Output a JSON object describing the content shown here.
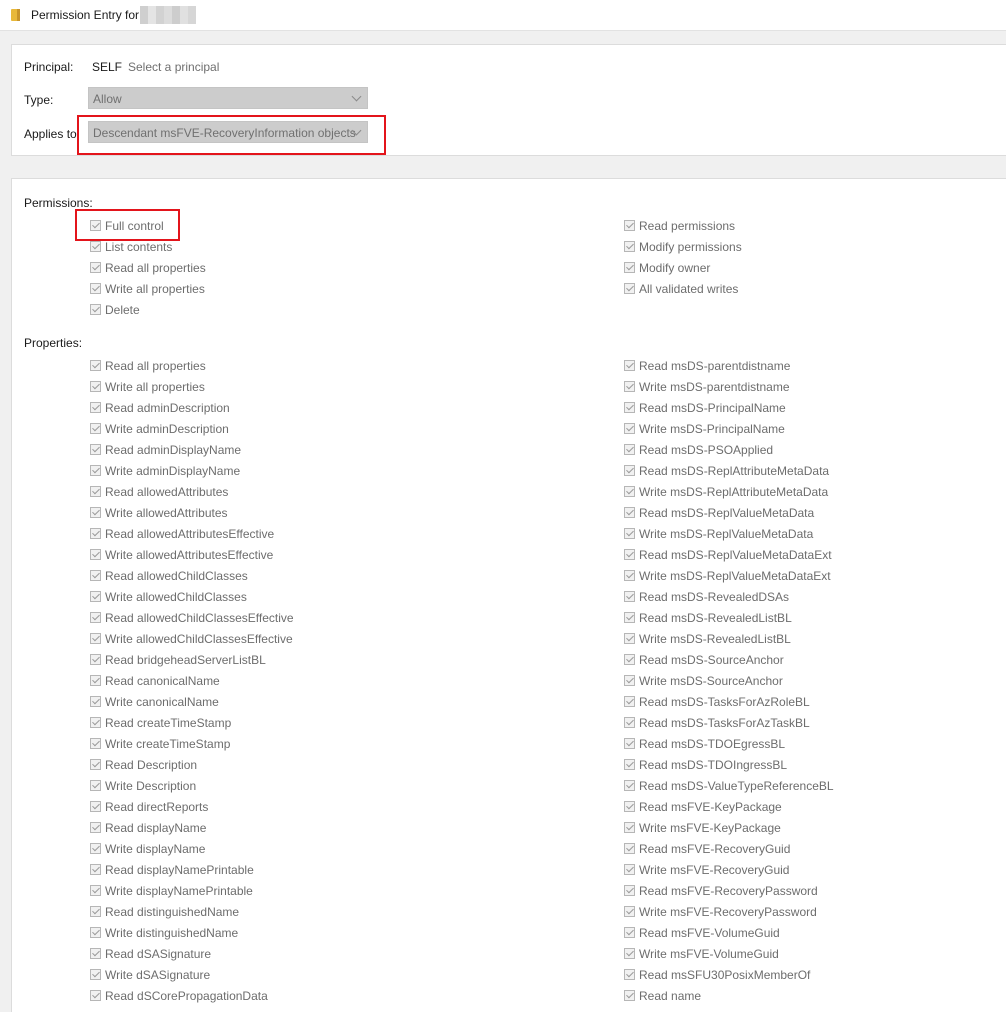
{
  "window": {
    "title": "Permission Entry for"
  },
  "principal": {
    "label": "Principal:",
    "value": "SELF",
    "select_link": "Select a principal"
  },
  "type": {
    "label": "Type:",
    "value": "Allow"
  },
  "applies_to": {
    "label": "Applies to:",
    "value": "Descendant msFVE-RecoveryInformation objects"
  },
  "permissions": {
    "label": "Permissions:",
    "left": [
      "Full control",
      "List contents",
      "Read all properties",
      "Write all properties",
      "Delete"
    ],
    "right": [
      "Read permissions",
      "Modify permissions",
      "Modify owner",
      "All validated writes"
    ]
  },
  "properties": {
    "label": "Properties:",
    "left": [
      "Read all properties",
      "Write all properties",
      "Read adminDescription",
      "Write adminDescription",
      "Read adminDisplayName",
      "Write adminDisplayName",
      "Read allowedAttributes",
      "Write allowedAttributes",
      "Read allowedAttributesEffective",
      "Write allowedAttributesEffective",
      "Read allowedChildClasses",
      "Write allowedChildClasses",
      "Read allowedChildClassesEffective",
      "Write allowedChildClassesEffective",
      "Read bridgeheadServerListBL",
      "Read canonicalName",
      "Write canonicalName",
      "Read createTimeStamp",
      "Write createTimeStamp",
      "Read Description",
      "Write Description",
      "Read directReports",
      "Read displayName",
      "Write displayName",
      "Read displayNamePrintable",
      "Write displayNamePrintable",
      "Read distinguishedName",
      "Write distinguishedName",
      "Read dSASignature",
      "Write dSASignature",
      "Read dSCorePropagationData"
    ],
    "right": [
      "Read msDS-parentdistname",
      "Write msDS-parentdistname",
      "Read msDS-PrincipalName",
      "Write msDS-PrincipalName",
      "Read msDS-PSOApplied",
      "Read msDS-ReplAttributeMetaData",
      "Write msDS-ReplAttributeMetaData",
      "Read msDS-ReplValueMetaData",
      "Write msDS-ReplValueMetaData",
      "Read msDS-ReplValueMetaDataExt",
      "Write msDS-ReplValueMetaDataExt",
      "Read msDS-RevealedDSAs",
      "Read msDS-RevealedListBL",
      "Write msDS-RevealedListBL",
      "Read msDS-SourceAnchor",
      "Write msDS-SourceAnchor",
      "Read msDS-TasksForAzRoleBL",
      "Read msDS-TasksForAzTaskBL",
      "Read msDS-TDOEgressBL",
      "Read msDS-TDOIngressBL",
      "Read msDS-ValueTypeReferenceBL",
      "Read msFVE-KeyPackage",
      "Write msFVE-KeyPackage",
      "Read msFVE-RecoveryGuid",
      "Write msFVE-RecoveryGuid",
      "Read msFVE-RecoveryPassword",
      "Write msFVE-RecoveryPassword",
      "Read msFVE-VolumeGuid",
      "Write msFVE-VolumeGuid",
      "Read msSFU30PosixMemberOf",
      "Read name"
    ]
  }
}
